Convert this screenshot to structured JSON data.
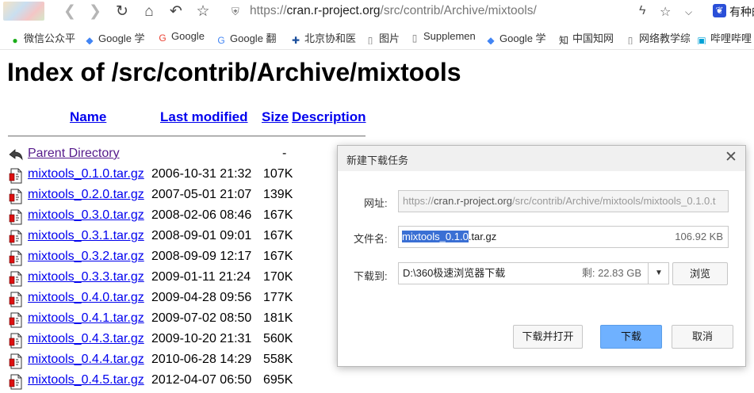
{
  "browser": {
    "url_prefix": "https://",
    "url_host": "cran.r-project.org",
    "url_path": "/src/contrib/Archive/mixtools/",
    "user_label": "有种的"
  },
  "bookmarks": [
    {
      "label": "微信公众平",
      "icon": "wechat-icon",
      "color": "#1aad19"
    },
    {
      "label": "Google 学",
      "icon": "scholar-icon",
      "color": "#4285f4"
    },
    {
      "label": "Google",
      "icon": "google-icon",
      "color": "#ea4335"
    },
    {
      "label": "Google 翻",
      "icon": "translate-icon",
      "color": "#4285f4"
    },
    {
      "label": "北京协和医",
      "icon": "pumch-icon",
      "color": "#1b4f9c"
    },
    {
      "label": "图片",
      "icon": "page-icon",
      "color": "#777777"
    },
    {
      "label": "Supplemen",
      "icon": "page-icon",
      "color": "#777777"
    },
    {
      "label": "Google 学",
      "icon": "scholar-icon",
      "color": "#4285f4"
    },
    {
      "label": "中国知网",
      "icon": "cnki-icon",
      "color": "#333333"
    },
    {
      "label": "网络教学综",
      "icon": "page-icon",
      "color": "#777777"
    },
    {
      "label": "哔哩哔哩",
      "icon": "bilibili-icon",
      "color": "#00a1d6"
    }
  ],
  "page": {
    "title": "Index of /src/contrib/Archive/mixtools",
    "columns": {
      "name": "Name",
      "modified": "Last modified",
      "size": "Size",
      "description": "Description"
    },
    "parent": {
      "name": "Parent Directory",
      "size": "-"
    },
    "files": [
      {
        "name": "mixtools_0.1.0.tar.gz",
        "date": "2006-10-31 21:32",
        "size": "107K"
      },
      {
        "name": "mixtools_0.2.0.tar.gz",
        "date": "2007-05-01 21:07",
        "size": "139K"
      },
      {
        "name": "mixtools_0.3.0.tar.gz",
        "date": "2008-02-06 08:46",
        "size": "167K"
      },
      {
        "name": "mixtools_0.3.1.tar.gz",
        "date": "2008-09-01 09:01",
        "size": "167K"
      },
      {
        "name": "mixtools_0.3.2.tar.gz",
        "date": "2008-09-09 12:17",
        "size": "167K"
      },
      {
        "name": "mixtools_0.3.3.tar.gz",
        "date": "2009-01-11 21:24",
        "size": "170K"
      },
      {
        "name": "mixtools_0.4.0.tar.gz",
        "date": "2009-04-28 09:56",
        "size": "177K"
      },
      {
        "name": "mixtools_0.4.1.tar.gz",
        "date": "2009-07-02 08:50",
        "size": "181K"
      },
      {
        "name": "mixtools_0.4.3.tar.gz",
        "date": "2009-10-20 21:31",
        "size": "560K"
      },
      {
        "name": "mixtools_0.4.4.tar.gz",
        "date": "2010-06-28 14:29",
        "size": "558K"
      },
      {
        "name": "mixtools_0.4.5.tar.gz",
        "date": "2012-04-07 06:50",
        "size": "695K"
      }
    ]
  },
  "dialog": {
    "title": "新建下载任务",
    "url_label": "网址:",
    "url_prefix": "https://",
    "url_host": "cran.r-project.org",
    "url_path": "/src/contrib/Archive/mixtools/mixtools_0.1.0.t",
    "filename_label": "文件名:",
    "filename_selected": "mixtools_0.1.0",
    "filename_rest": ".tar.gz",
    "filesize": "106.92 KB",
    "saveto_label": "下载到:",
    "save_path": "D:\\360极速浏览器下载",
    "free_space": "剩: 22.83 GB",
    "browse_button": "浏览",
    "download_open_button": "下载并打开",
    "download_button": "下载",
    "cancel_button": "取消"
  }
}
